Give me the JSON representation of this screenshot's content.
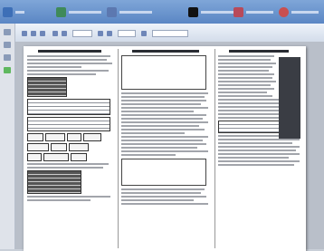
{
  "window": {
    "title": "",
    "taskbar_items": [
      {
        "icon": "app-icon",
        "color": "#3d6fb7",
        "label": ""
      },
      {
        "icon": "app-icon",
        "color": "#3f8a5a",
        "label": ""
      },
      {
        "icon": "app-icon",
        "color": "#5c78b0",
        "label": ""
      },
      {
        "icon": "app-icon",
        "color": "#111111",
        "label": ""
      },
      {
        "icon": "app-icon",
        "color": "#b84a5a",
        "label": ""
      },
      {
        "icon": "app-icon",
        "color": "#c94f4f",
        "label": ""
      }
    ]
  },
  "toolbar": {
    "zoom_value": "",
    "page_value": "",
    "search_placeholder": ""
  },
  "document": {
    "columns": [
      {
        "heading": ""
      },
      {
        "heading": ""
      },
      {
        "heading": ""
      }
    ]
  },
  "colors": {
    "taskbar": "#6a93cc",
    "toolbar": "#e3e9f3",
    "rail_accent": "#5fb85f"
  }
}
